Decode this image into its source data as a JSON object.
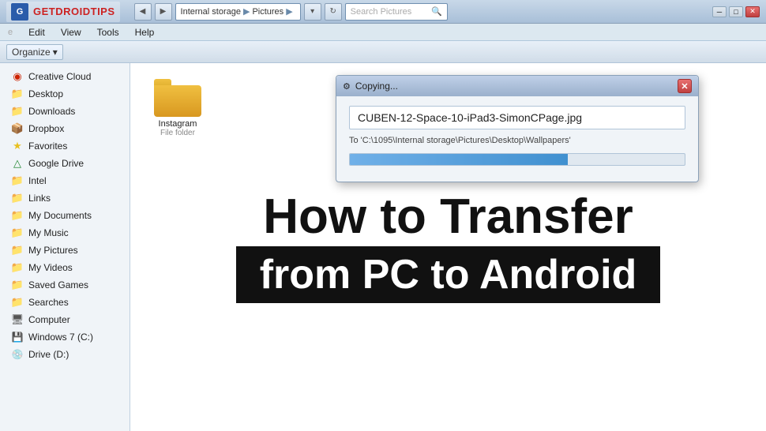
{
  "titlebar": {
    "logo_text_get": "GET",
    "logo_text_droid": "DROID",
    "logo_text_tips": "TIPS"
  },
  "addressbar": {
    "breadcrumb_1": "Internal storage",
    "breadcrumb_2": "Pictures",
    "search_placeholder": "Search Pictures"
  },
  "menubar": {
    "item_file": "e",
    "item_edit": "Edit",
    "item_view": "View",
    "item_tools": "Tools",
    "item_help": "Help"
  },
  "toolbar": {
    "organize_label": "Organize",
    "dropdown_arrow": "▾"
  },
  "sidebar": {
    "items": [
      {
        "label": "Creative Cloud",
        "icon": "red-circle"
      },
      {
        "label": "Desktop",
        "icon": "folder"
      },
      {
        "label": "Downloads",
        "icon": "folder-blue"
      },
      {
        "label": "Dropbox",
        "icon": "folder-blue"
      },
      {
        "label": "Favorites",
        "icon": "star"
      },
      {
        "label": "Google Drive",
        "icon": "folder-green"
      },
      {
        "label": "Intel",
        "icon": "folder"
      },
      {
        "label": "Links",
        "icon": "folder"
      },
      {
        "label": "My Documents",
        "icon": "folder-blue"
      },
      {
        "label": "My Music",
        "icon": "folder-blue"
      },
      {
        "label": "My Pictures",
        "icon": "folder-blue"
      },
      {
        "label": "My Videos",
        "icon": "folder-blue"
      },
      {
        "label": "Saved Games",
        "icon": "folder"
      },
      {
        "label": "Searches",
        "icon": "folder"
      },
      {
        "label": "Computer",
        "icon": "computer"
      },
      {
        "label": "Windows 7 (C:)",
        "icon": "drive"
      },
      {
        "label": "Drive (D:)",
        "icon": "drive"
      }
    ]
  },
  "file_area": {
    "folder_name": "Instagram",
    "folder_type": "File folder"
  },
  "overlay": {
    "headline": "How to Transfer",
    "subheadline": "from PC to Android"
  },
  "copy_dialog": {
    "title": "Copying...",
    "filename": "CUBEN-12-Space-10-iPad3-SimonCPage.jpg",
    "destination": "To 'C:\\1095\\Internal storage\\Pictures\\Desktop\\Wallpapers'",
    "progress_percent": 65,
    "close_btn": "✕",
    "icon": "⚙"
  }
}
